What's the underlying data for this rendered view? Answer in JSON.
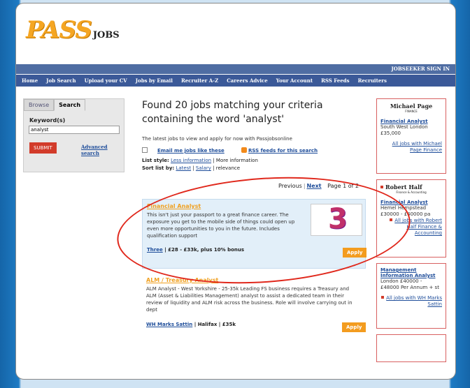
{
  "logo": {
    "main": "PASS",
    "sub": "JOBS"
  },
  "topbar": {
    "signin": "JOBSEEKER SIGN IN"
  },
  "nav": [
    "Home",
    "Job Search",
    "Upload your CV",
    "Jobs by Email",
    "Recruiter A-Z",
    "Careers Advice",
    "Your Account",
    "RSS Feeds",
    "Recruiters"
  ],
  "search": {
    "tabs": [
      "Browse",
      "Search"
    ],
    "active_tab": "Search",
    "keyword_label": "Keyword(s)",
    "keyword_value": "analyst",
    "submit": "SUBMIT",
    "advanced": "Advanced search"
  },
  "results": {
    "title": "Found 20 jobs matching your criteria containing the word 'analyst'",
    "intro": "The latest jobs to view and apply for now with Passjobsonline",
    "email_link": "Email me jobs like these",
    "rss_link": "RSS feeds for this search",
    "list_style_label": "List style:",
    "list_style_less": "Less information",
    "list_style_more": "| More information",
    "sort_label": "Sort list by:",
    "sort_latest": "Latest",
    "sort_salary": "Salary",
    "sort_relevance": "| relevance",
    "pager_previous": "Previous",
    "pager_next": "Next",
    "pager_page": "Page 1 of 2"
  },
  "jobs": [
    {
      "title": "Financial Analyst",
      "description": "This isn't just your passport to a great finance career. The exposure you get to the mobile side of things could open up even more opportunities to you in the future. Includes qualification support",
      "company": "Three",
      "details": " | £28 - £33k, plus 10% bonus",
      "logo_text": "3",
      "apply": "Apply"
    },
    {
      "title": "ALM / Treasury Analyst",
      "description": "ALM Analyst - West Yorkshire - 25-35k Leading FS business requires a Treasury and ALM (Asset & Liabilities Management) analyst to assist a dedicated team in their review of liquidity and ALM risk across the business. Role will involve carrying out in dept",
      "company": "WH Marks Sattin",
      "details": " | Halifax | £35k",
      "apply": "Apply"
    }
  ],
  "sidebar": [
    {
      "brand": "Michael Page",
      "brand_sub": "FINANCE",
      "title": "Financial Analyst",
      "location": "South West London",
      "salary": "£35,000",
      "all_link": "All jobs with Michael Page Finance"
    },
    {
      "brand": "Robert Half",
      "brand_sub": "Finance & Accounting",
      "title": "Financial Analyst",
      "location": "Hemel Hempstead",
      "salary": "£30000 - £40000 pa",
      "all_link": "All jobs with Robert Half Finance & Accounting"
    },
    {
      "title": "Management Information Analyst",
      "location": "London £40000 -",
      "salary": "£48000 Per Annum + st",
      "all_link": "All jobs with WH Marks Sattin"
    }
  ],
  "colors": {
    "nav": "#3b5998",
    "accent": "#f39c1f",
    "link": "#1e4d9a",
    "highlight": "#e0281c"
  }
}
